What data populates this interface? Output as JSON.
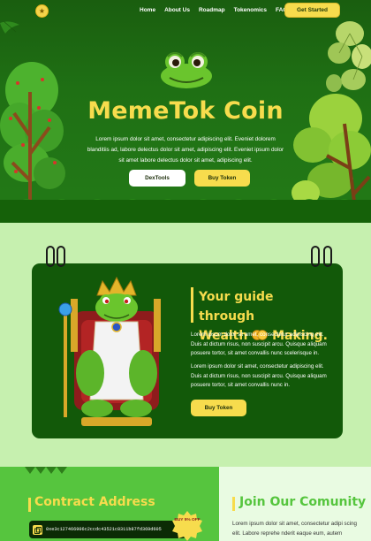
{
  "nav": {
    "logo_glyph": "★",
    "links": [
      "Home",
      "About Us",
      "Roadmap",
      "Tokenomics",
      "FAQ"
    ],
    "cta": "Get Started"
  },
  "hero": {
    "title": "MemeTok Coin",
    "description": "Lorem ipsum dolor sit amet, consectetur adipiscing elit. Eveniet dolorem blanditiis ad, labore delectus dolor sit amet, adipiscing elit. Eveniet ipsum dolor sit amet labore delectus dolor sit amet, adipiscing elit.",
    "button_primary": "DexTools",
    "button_secondary": "Buy Token"
  },
  "guide": {
    "heading_line1": "Your guide through",
    "heading_line2_prefix": "Wealth",
    "heading_line2_suffix": "Making.",
    "paragraph1": "Lorem ipsum dolor sit amet, consectetur adipiscing elit. Duis at dictum risus, non suscipit arcu. Quisque aliquam posuere tortor, sit amet convallis nunc scelerisque in.",
    "paragraph2": "Lorem ipsum dolor sit amet, consectetur adipiscing elit. Duis at dictum risus, non suscipit arcu. Quisque aliquam posuere tortor, sit amet convallis nunc in.",
    "button": "Buy Token"
  },
  "contract": {
    "title": "Contract Address",
    "address": "0xe3c127466906c2ccdc43521c8311b87fd369d605",
    "badge": "BUY 5% OFF"
  },
  "community": {
    "title": "Join Our Comunity",
    "text": "Lorem ipsum dolor sit amet, consectetur adipi scing elit. Labore reprehe nderit eaque eum, autem"
  },
  "colors": {
    "hero_green": "#1e6b12",
    "card_green": "#125909",
    "accent_yellow": "#f7dc4d",
    "light_green_bg": "#c6f0af",
    "contract_green": "#56c53e"
  }
}
